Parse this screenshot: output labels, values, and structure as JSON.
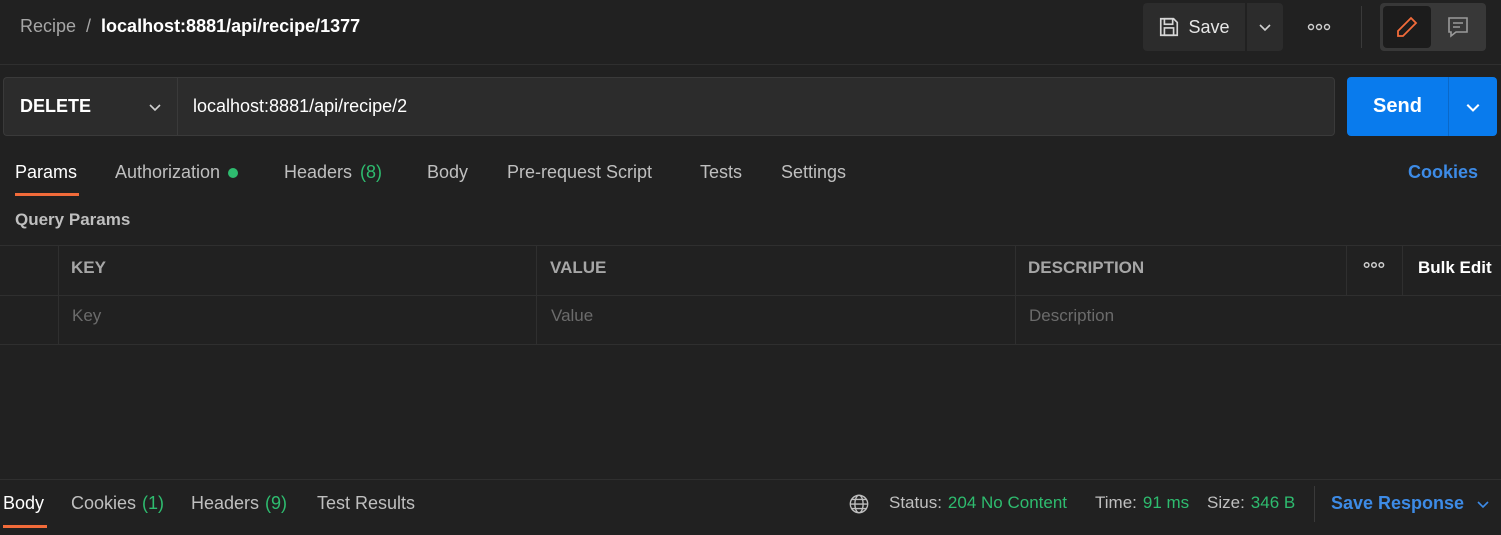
{
  "header": {
    "collection": "Recipe",
    "separator": "/",
    "request_name": "localhost:8881/api/recipe/1377",
    "save_label": "Save",
    "more_icon": "more-horizontal-icon",
    "edit_icon": "pencil-icon",
    "comment_icon": "comment-icon"
  },
  "request": {
    "method": "DELETE",
    "url": "localhost:8881/api/recipe/2",
    "send_label": "Send"
  },
  "tabs": [
    {
      "label": "Params",
      "active": true
    },
    {
      "label": "Authorization",
      "indicator": "green-dot"
    },
    {
      "label": "Headers",
      "count": "(8)"
    },
    {
      "label": "Body"
    },
    {
      "label": "Pre-request Script"
    },
    {
      "label": "Tests"
    },
    {
      "label": "Settings"
    }
  ],
  "cookies_link": "Cookies",
  "query_params": {
    "title": "Query Params",
    "headers": {
      "key": "KEY",
      "value": "VALUE",
      "description": "DESCRIPTION"
    },
    "bulk_edit": "Bulk Edit",
    "placeholders": {
      "key": "Key",
      "value": "Value",
      "description": "Description"
    }
  },
  "response": {
    "tabs": [
      {
        "label": "Body",
        "active": true
      },
      {
        "label": "Cookies",
        "count": "(1)"
      },
      {
        "label": "Headers",
        "count": "(9)"
      },
      {
        "label": "Test Results"
      }
    ],
    "status_label": "Status:",
    "status_value": "204 No Content",
    "time_label": "Time:",
    "time_value": "91 ms",
    "size_label": "Size:",
    "size_value": "346 B",
    "save_response": "Save Response"
  },
  "colors": {
    "background": "#212121",
    "accent_orange": "#f26b3a",
    "send_blue": "#097bed",
    "link_blue": "#3d8be6",
    "success_green": "#2ebc6f"
  }
}
